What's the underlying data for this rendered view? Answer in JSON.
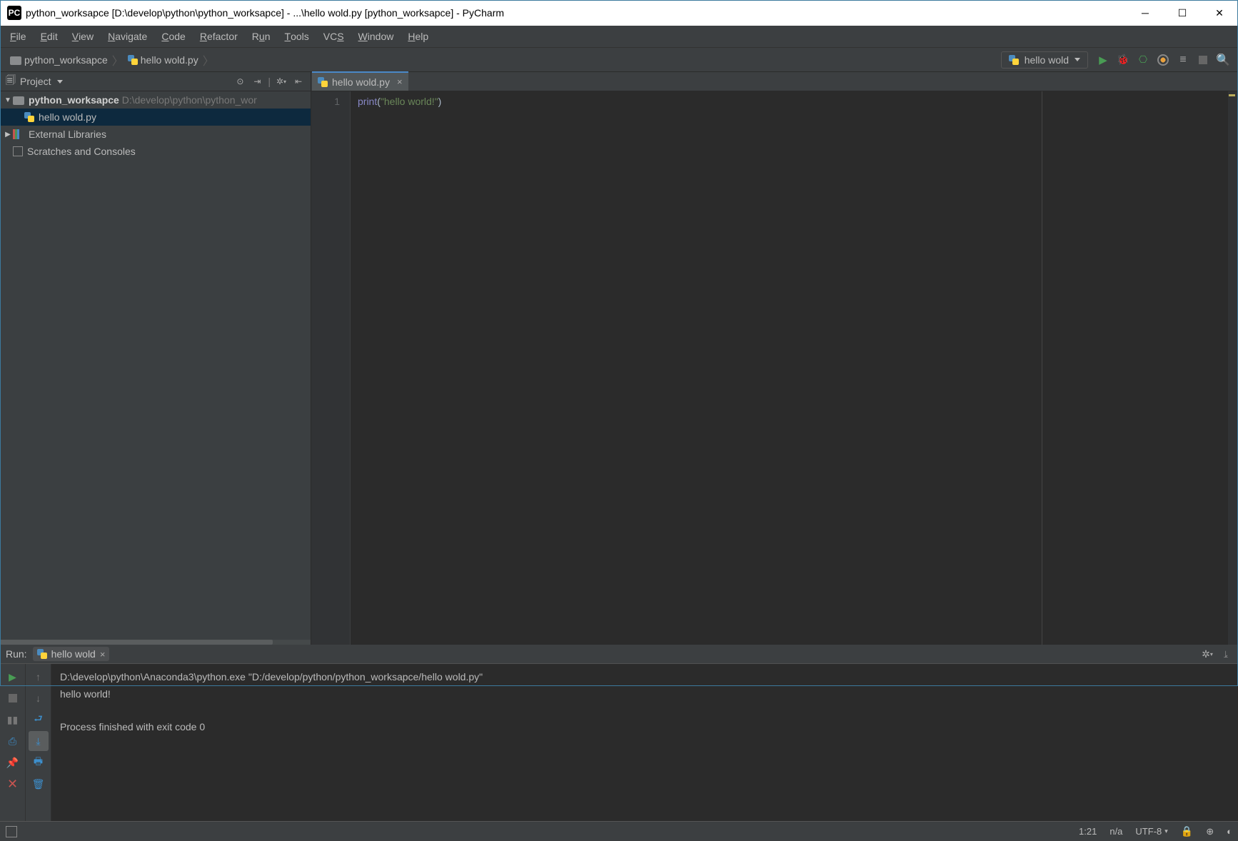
{
  "window": {
    "title": "python_worksapce [D:\\develop\\python\\python_worksapce] - ...\\hello wold.py [python_worksapce] - PyCharm"
  },
  "menubar": [
    "File",
    "Edit",
    "View",
    "Navigate",
    "Code",
    "Refactor",
    "Run",
    "Tools",
    "VCS",
    "Window",
    "Help"
  ],
  "breadcrumb": {
    "root": "python_worksapce",
    "file": "hello wold.py"
  },
  "run_config_selector": "hello wold",
  "project_panel": {
    "title": "Project",
    "root": {
      "name": "python_worksapce",
      "path": "D:\\develop\\python\\python_wor"
    },
    "file": "hello wold.py",
    "ext": "External Libraries",
    "scratch": "Scratches and Consoles"
  },
  "editor": {
    "tab_name": "hello wold.py",
    "line_no": "1",
    "code_func": "print",
    "code_paren_open": "(",
    "code_string": "\"hello world!\"",
    "code_paren_close": ")"
  },
  "run_panel": {
    "label": "Run:",
    "tab": "hello wold",
    "out_cmd": "D:\\develop\\python\\Anaconda3\\python.exe \"D:/develop/python/python_worksapce/hello wold.py\"",
    "out_line": "hello world!",
    "out_exit": "Process finished with exit code 0"
  },
  "statusbar": {
    "pos": "1:21",
    "insert": "n/a",
    "encoding": "UTF-8"
  }
}
